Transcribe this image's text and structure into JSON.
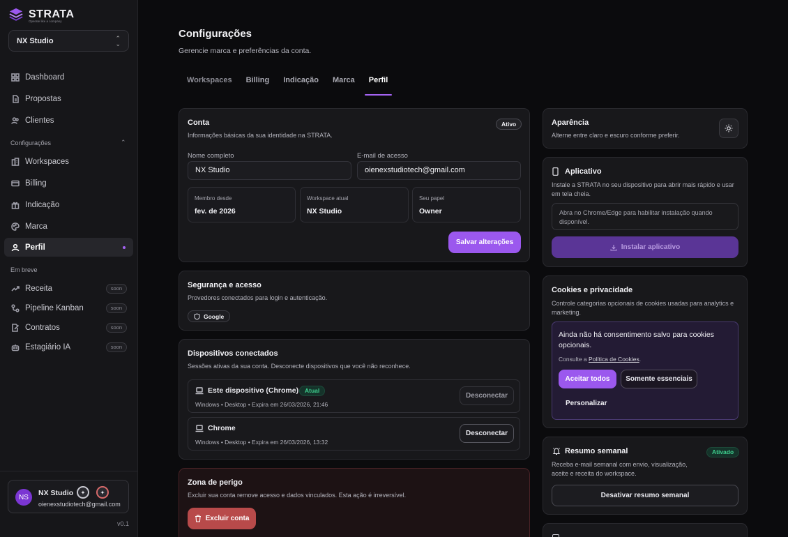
{
  "brand": {
    "name": "STRATA",
    "tagline": "Operate like a company"
  },
  "workspace_selector": {
    "value": "NX Studio"
  },
  "nav": {
    "items": [
      {
        "label": "Dashboard"
      },
      {
        "label": "Propostas"
      },
      {
        "label": "Clientes"
      }
    ],
    "config_section": "Configurações",
    "config_items": [
      {
        "label": "Workspaces"
      },
      {
        "label": "Billing"
      },
      {
        "label": "Indicação"
      },
      {
        "label": "Marca"
      },
      {
        "label": "Perfil"
      }
    ],
    "soon_section": "Em breve",
    "soon_items": [
      {
        "label": "Receita",
        "badge": "soon"
      },
      {
        "label": "Pipeline Kanban",
        "badge": "soon"
      },
      {
        "label": "Contratos",
        "badge": "soon"
      },
      {
        "label": "Estagiário IA",
        "badge": "soon"
      }
    ]
  },
  "user": {
    "initials": "NS",
    "name": "NX Studio",
    "email": "oienexstudiotech@gmail.com"
  },
  "version": "v0.1",
  "header": {
    "title": "Configurações",
    "subtitle": "Gerencie marca e preferências da conta."
  },
  "tabs": [
    {
      "label": "Workspaces"
    },
    {
      "label": "Billing"
    },
    {
      "label": "Indicação"
    },
    {
      "label": "Marca"
    },
    {
      "label": "Perfil"
    }
  ],
  "account": {
    "title": "Conta",
    "subtitle": "Informações básicas da sua identidade na STRATA.",
    "status": "Ativo",
    "name_label": "Nome completo",
    "name_value": "NX Studio",
    "email_label": "E-mail de acesso",
    "email_value": "oienexstudiotech@gmail.com",
    "member_since_label": "Membro desde",
    "member_since_value": "fev. de 2026",
    "workspace_label": "Workspace atual",
    "workspace_value": "NX Studio",
    "role_label": "Seu papel",
    "role_value": "Owner",
    "save_label": "Salvar alterações"
  },
  "security": {
    "title": "Segurança e acesso",
    "subtitle": "Provedores conectados para login e autenticação.",
    "provider": "Google"
  },
  "devices": {
    "title": "Dispositivos conectados",
    "subtitle": "Sessões ativas da sua conta. Desconecte dispositivos que você não reconhece.",
    "list": [
      {
        "name": "Este dispositivo (Chrome)",
        "badge": "Atual",
        "meta": "Windows • Desktop • Expira em 26/03/2026, 21:46",
        "action": "Desconectar"
      },
      {
        "name": "Chrome",
        "meta": "Windows • Desktop • Expira em 26/03/2026, 13:32",
        "action": "Desconectar"
      }
    ]
  },
  "danger": {
    "title": "Zona de perigo",
    "subtitle": "Excluir sua conta remove acesso e dados vinculados. Esta ação é irreversível.",
    "delete_label": "Excluir conta"
  },
  "appearance": {
    "title": "Aparência",
    "subtitle": "Alterne entre claro e escuro conforme preferir."
  },
  "app": {
    "title": "Aplicativo",
    "subtitle": "Instale a STRATA no seu dispositivo para abrir mais rápido e usar em tela cheia.",
    "hint": "Abra no Chrome/Edge para habilitar instalação quando disponível.",
    "install_label": "Instalar aplicativo"
  },
  "cookies": {
    "title": "Cookies e privacidade",
    "subtitle": "Controle categorias opcionais de cookies usadas para analytics e marketing.",
    "notice": "Ainda não há consentimento salvo para cookies opcionais.",
    "policy_prefix": "Consulte a ",
    "policy_link": "Política de Cookies",
    "policy_suffix": ".",
    "accept_all": "Aceitar todos",
    "essential_only": "Somente essenciais",
    "customize": "Personalizar"
  },
  "weekly": {
    "title": "Resumo semanal",
    "status": "Ativado",
    "subtitle": "Receba e-mail semanal com envio, visualização, aceite e receita do workspace.",
    "action": "Desativar resumo semanal"
  },
  "colors": {
    "accent": "#9b58ee",
    "success": "#3ecf8e",
    "danger": "#c24848",
    "background": "#0b0b0d"
  }
}
